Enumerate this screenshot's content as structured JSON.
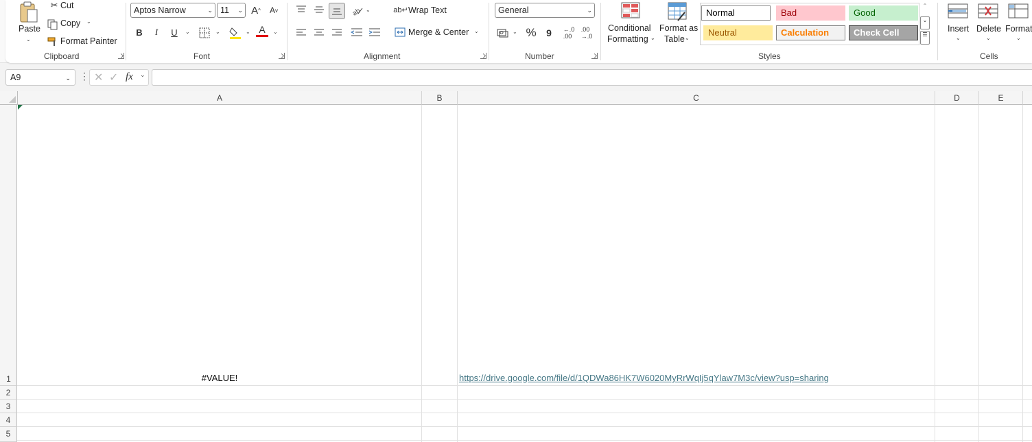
{
  "ribbon": {
    "clipboard": {
      "paste_label": "Paste",
      "cut_label": "Cut",
      "copy_label": "Copy",
      "format_painter_label": "Format Painter",
      "group_label": "Clipboard"
    },
    "font": {
      "font_name": "Aptos Narrow",
      "font_size": "11",
      "bold_label": "B",
      "italic_label": "I",
      "underline_label": "U",
      "font_color_glyph": "A",
      "increase_font_glyph": "A",
      "decrease_font_glyph": "A",
      "group_label": "Font"
    },
    "alignment": {
      "wrap_text_label": "Wrap Text",
      "merge_center_label": "Merge & Center",
      "group_label": "Alignment"
    },
    "number": {
      "format_value": "General",
      "percent_glyph": "%",
      "comma_glyph": "9",
      "group_label": "Number"
    },
    "styles": {
      "conditional_formatting_line1": "Conditional",
      "conditional_formatting_line2": "Formatting",
      "format_as_table_line1": "Format as",
      "format_as_table_line2": "Table",
      "gallery": [
        {
          "label": "Normal",
          "bg": "#ffffff",
          "fg": "#000000",
          "border": "#8a8a8a"
        },
        {
          "label": "Bad",
          "bg": "#ffc7ce",
          "fg": "#9c0006",
          "border": "#ffc7ce"
        },
        {
          "label": "Good",
          "bg": "#c6efce",
          "fg": "#006100",
          "border": "#c6efce"
        },
        {
          "label": "Neutral",
          "bg": "#ffeb9c",
          "fg": "#9c5700",
          "border": "#ffeb9c"
        },
        {
          "label": "Calculation",
          "bg": "#f2f2f2",
          "fg": "#fa7d00",
          "border": "#7f7f7f"
        },
        {
          "label": "Check Cell",
          "bg": "#a5a5a5",
          "fg": "#ffffff",
          "border": "#3f3f3f"
        }
      ],
      "group_label": "Styles"
    },
    "cells": {
      "insert_label": "Insert",
      "delete_label": "Delete",
      "format_label": "Format",
      "group_label": "Cells"
    }
  },
  "formula_bar": {
    "name_box": "A9",
    "fx_label": "fx",
    "formula": ""
  },
  "sheet": {
    "columns": [
      "A",
      "B",
      "C",
      "D",
      "E"
    ],
    "rows": [
      "1",
      "2",
      "3",
      "4",
      "5"
    ],
    "cells": {
      "A1": "#VALUE!",
      "C1": "https://drive.google.com/file/d/1QDWa86HK7W6020MyRrWqIj5qYlaw7M3c/view?usp=sharing"
    }
  },
  "colors": {
    "accent_green": "#217346",
    "link": "#467886",
    "header_bg": "#f5f5f5"
  }
}
